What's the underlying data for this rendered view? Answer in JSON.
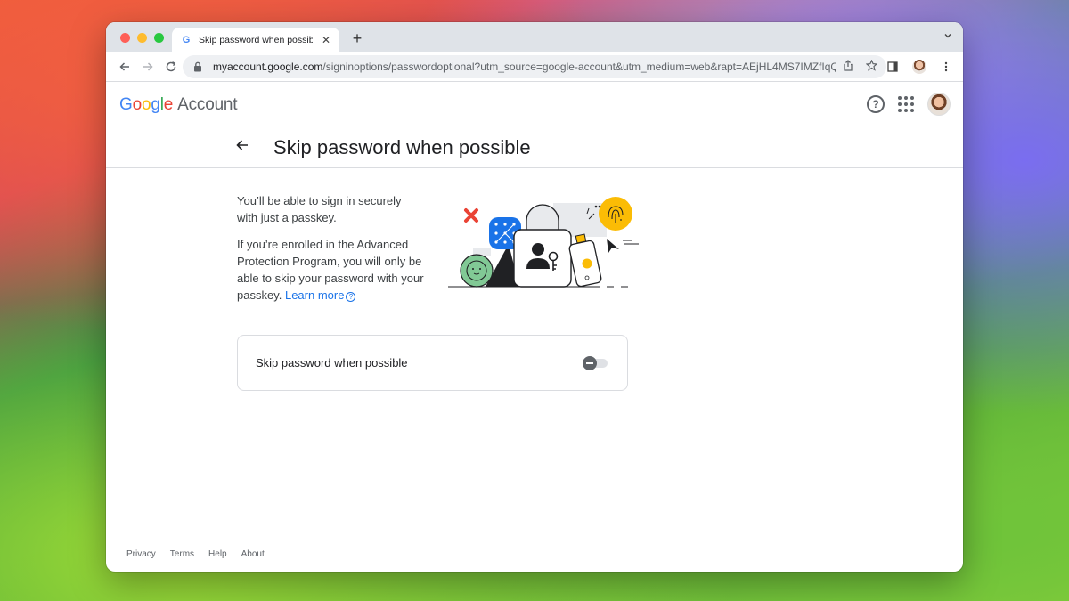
{
  "browser": {
    "tab_title": "Skip password when possible",
    "tab_favicon": "G",
    "new_tab": "+",
    "url_host": "myaccount.google.com",
    "url_path": "/signinoptions/passwordoptional?utm_source=google-account&utm_medium=web&rapt=AEjHL4MS7IMZfIqQ..."
  },
  "header": {
    "logo": {
      "G": "G",
      "o1": "o",
      "o2": "o",
      "g": "g",
      "l": "l",
      "e": "e"
    },
    "account_label": "Account",
    "help_glyph": "?"
  },
  "page": {
    "title": "Skip password when possible",
    "paragraph1": "You’ll be able to sign in securely with just a passkey.",
    "paragraph2": "If you’re enrolled in the Advanced Protection Program, you will only be able to skip your password with your passkey.",
    "learn_more": "Learn more",
    "info_glyph": "?"
  },
  "setting": {
    "label": "Skip password when possible",
    "enabled": false
  },
  "footer": {
    "links": [
      "Privacy",
      "Terms",
      "Help",
      "About"
    ]
  },
  "colors": {
    "accent": "#1a73e8",
    "google_blue": "#4285f4",
    "google_red": "#ea4335",
    "google_yellow": "#fbbc05",
    "google_green": "#34a853"
  }
}
